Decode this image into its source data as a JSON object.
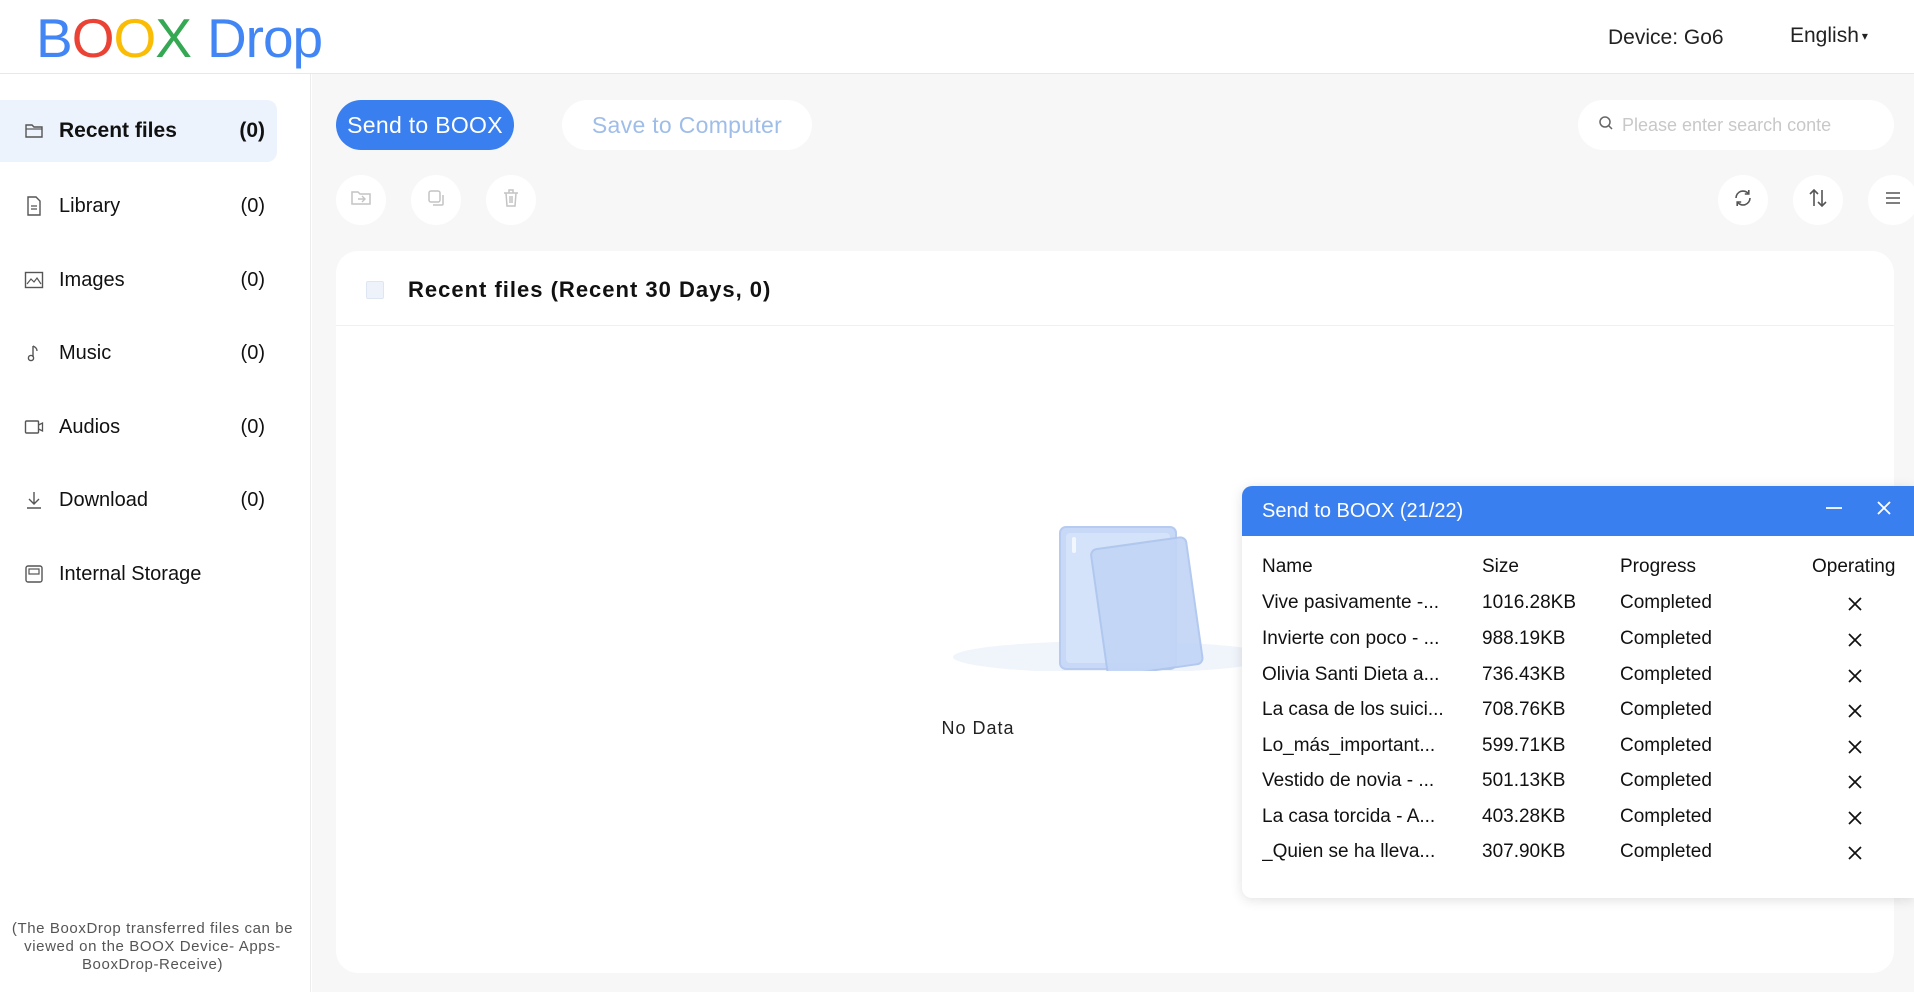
{
  "header": {
    "logo": {
      "b": "B",
      "o1": "O",
      "o2": "O",
      "x": "X",
      "drop": "Drop"
    },
    "device_label": "Device:  Go6",
    "language": "English"
  },
  "sidebar": {
    "items": [
      {
        "label": "Recent files",
        "count": "(0)",
        "icon": "folder-icon",
        "active": true
      },
      {
        "label": "Library",
        "count": "(0)",
        "icon": "document-icon"
      },
      {
        "label": "Images",
        "count": "(0)",
        "icon": "image-icon"
      },
      {
        "label": "Music",
        "count": "(0)",
        "icon": "music-note-icon"
      },
      {
        "label": "Audios",
        "count": "(0)",
        "icon": "audio-icon"
      },
      {
        "label": "Download",
        "count": "(0)",
        "icon": "download-icon"
      },
      {
        "label": "Internal Storage",
        "count": "",
        "icon": "storage-icon"
      }
    ],
    "note": "(The BooxDrop transferred files can be viewed on the BOOX Device- Apps-BooxDrop-Receive)"
  },
  "toolbar": {
    "send_label": "Send to BOOX",
    "save_label": "Save to Computer",
    "search_placeholder": "Please enter search conte"
  },
  "panel": {
    "title": "Recent files (Recent 30 Days, 0)",
    "empty_text": "No Data"
  },
  "popup": {
    "title": "Send to BOOX  (21/22)",
    "columns": {
      "name": "Name",
      "size": "Size",
      "progress": "Progress",
      "operating": "Operating"
    },
    "rows": [
      {
        "name": "Vive pasivamente -...",
        "size": "1016.28KB",
        "progress": "Completed"
      },
      {
        "name": "Invierte con poco - ...",
        "size": "988.19KB",
        "progress": "Completed"
      },
      {
        "name": "Olivia Santi Dieta a...",
        "size": "736.43KB",
        "progress": "Completed"
      },
      {
        "name": "La casa de los suici...",
        "size": "708.76KB",
        "progress": "Completed"
      },
      {
        "name": "Lo_más_important...",
        "size": "599.71KB",
        "progress": "Completed"
      },
      {
        "name": "Vestido de novia - ...",
        "size": "501.13KB",
        "progress": "Completed"
      },
      {
        "name": "La casa torcida - A...",
        "size": "403.28KB",
        "progress": "Completed"
      },
      {
        "name": "_Quien se ha lleva...",
        "size": "307.90KB",
        "progress": "Completed"
      }
    ]
  },
  "colors": {
    "accent": "#3a7ff0",
    "active_bg": "#edf3fd",
    "main_bg": "#f7f7f7"
  }
}
